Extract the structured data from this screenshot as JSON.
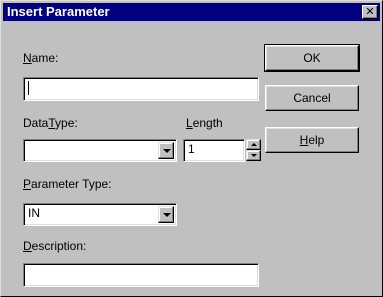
{
  "window": {
    "title": "Insert Parameter",
    "close_glyph": "✕"
  },
  "labels": {
    "name_prefix": "",
    "name_mnemonic": "N",
    "name_rest": "ame:",
    "datatype_prefix": "Data",
    "datatype_mnemonic": "T",
    "datatype_rest": "ype:",
    "length_prefix": "",
    "length_mnemonic": "L",
    "length_rest": "ength",
    "paramtype_prefix": "",
    "paramtype_mnemonic": "P",
    "paramtype_rest": "arameter Type:",
    "description_prefix": "",
    "description_mnemonic": "D",
    "description_rest": "escription:"
  },
  "fields": {
    "name_value": "",
    "datatype_value": "",
    "length_value": "1",
    "paramtype_value": "IN",
    "description_value": ""
  },
  "buttons": {
    "ok": "OK",
    "cancel": "Cancel",
    "help_mnemonic": "H",
    "help_rest": "elp"
  }
}
